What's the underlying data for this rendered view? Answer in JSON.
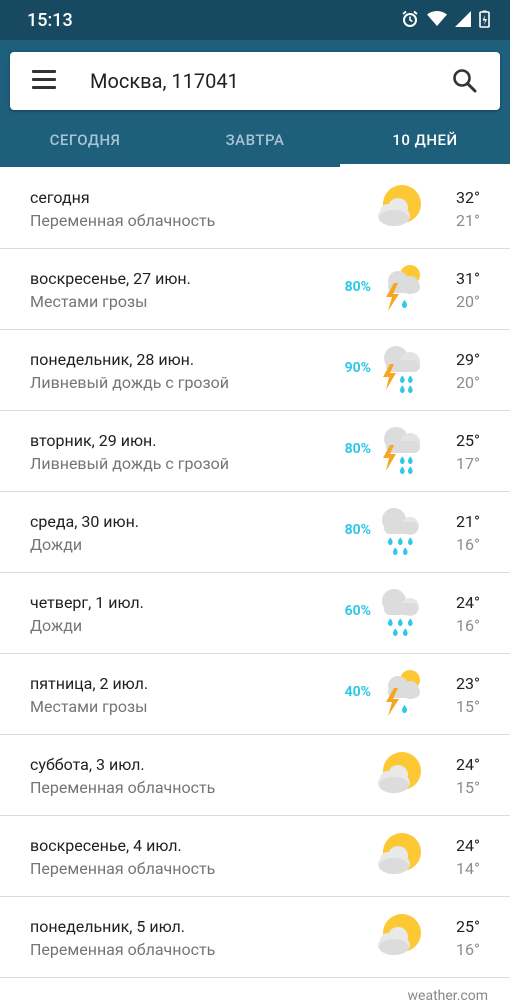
{
  "status": {
    "time": "15:13"
  },
  "search": {
    "location": "Москва, 117041"
  },
  "tabs": [
    {
      "label": "СЕГОДНЯ",
      "active": false
    },
    {
      "label": "ЗАВТРА",
      "active": false
    },
    {
      "label": "10 ДНЕЙ",
      "active": true
    }
  ],
  "forecast": [
    {
      "day": "сегодня",
      "desc": "Переменная облачность",
      "precip": "",
      "hi": "32°",
      "lo": "21°",
      "icon": "partly-cloudy-icon"
    },
    {
      "day": "воскресенье, 27 июн.",
      "desc": "Местами грозы",
      "precip": "80%",
      "hi": "31°",
      "lo": "20°",
      "icon": "scattered-thunderstorms-icon"
    },
    {
      "day": "понедельник, 28 июн.",
      "desc": "Ливневый дождь с грозой",
      "precip": "90%",
      "hi": "29°",
      "lo": "20°",
      "icon": "thunder-shower-icon"
    },
    {
      "day": "вторник, 29 июн.",
      "desc": "Ливневый дождь с грозой",
      "precip": "80%",
      "hi": "25°",
      "lo": "17°",
      "icon": "thunder-shower-icon"
    },
    {
      "day": "среда, 30 июн.",
      "desc": "Дожди",
      "precip": "80%",
      "hi": "21°",
      "lo": "16°",
      "icon": "rain-icon"
    },
    {
      "day": "четверг, 1 июл.",
      "desc": "Дожди",
      "precip": "60%",
      "hi": "24°",
      "lo": "16°",
      "icon": "rain-icon"
    },
    {
      "day": "пятница, 2 июл.",
      "desc": "Местами грозы",
      "precip": "40%",
      "hi": "23°",
      "lo": "15°",
      "icon": "scattered-thunderstorms-icon"
    },
    {
      "day": "суббота, 3 июл.",
      "desc": "Переменная облачность",
      "precip": "",
      "hi": "24°",
      "lo": "15°",
      "icon": "partly-cloudy-icon"
    },
    {
      "day": "воскресенье, 4 июл.",
      "desc": "Переменная облачность",
      "precip": "",
      "hi": "24°",
      "lo": "14°",
      "icon": "partly-cloudy-icon"
    },
    {
      "day": "понедельник, 5 июл.",
      "desc": "Переменная облачность",
      "precip": "",
      "hi": "25°",
      "lo": "16°",
      "icon": "partly-cloudy-icon"
    }
  ],
  "footer": {
    "source": "weather.com"
  },
  "colors": {
    "header": "#1e5f7c",
    "statusbar": "#174a61",
    "precip": "#2ec8e8",
    "sun": "#fcc935",
    "bolt": "#f5a623"
  }
}
